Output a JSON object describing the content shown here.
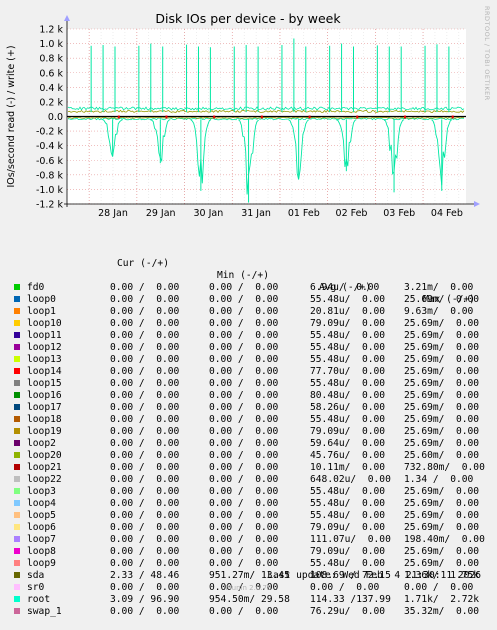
{
  "chart_data": {
    "type": "line",
    "title": "Disk IOs per device - by week",
    "ylabel": "IOs/second read (-) / write (+)",
    "ylim": [
      -1200,
      1200
    ],
    "yticks": [
      -1200,
      -1000,
      -800,
      -600,
      -400,
      -200,
      0,
      200,
      400,
      600,
      800,
      1000,
      1200
    ],
    "ytick_labels": [
      "-1.2 k",
      "-1.0 k",
      "-0.8 k",
      "-0.6 k",
      "-0.4 k",
      "-0.2 k",
      "0.0",
      "0.2 k",
      "0.4 k",
      "0.6 k",
      "0.8 k",
      "1.0 k",
      "1.2 k"
    ],
    "xticks": [
      "28 Jan",
      "29 Jan",
      "30 Jan",
      "31 Jan",
      "01 Feb",
      "02 Feb",
      "03 Feb",
      "04 Feb"
    ],
    "grid": true,
    "colors": {
      "sda": "#999900",
      "root": "#00e7a3",
      "loop14": "#ee0000",
      "baseline": "#000000"
    },
    "spikes_write": [
      {
        "day": 0.0,
        "v": 970
      },
      {
        "day": 0.25,
        "v": 980
      },
      {
        "day": 0.5,
        "v": 960
      },
      {
        "day": 1.0,
        "v": 970
      },
      {
        "day": 1.25,
        "v": 1000
      },
      {
        "day": 1.5,
        "v": 960
      },
      {
        "day": 2.0,
        "v": 985
      },
      {
        "day": 2.25,
        "v": 960
      },
      {
        "day": 2.5,
        "v": 950
      },
      {
        "day": 3.0,
        "v": 960
      },
      {
        "day": 3.25,
        "v": 980
      },
      {
        "day": 3.5,
        "v": 960
      },
      {
        "day": 4.0,
        "v": 980
      },
      {
        "day": 4.25,
        "v": 1070
      },
      {
        "day": 4.5,
        "v": 960
      },
      {
        "day": 5.0,
        "v": 970
      },
      {
        "day": 5.25,
        "v": 1000
      },
      {
        "day": 5.5,
        "v": 960
      },
      {
        "day": 6.0,
        "v": 975
      },
      {
        "day": 6.25,
        "v": 960
      },
      {
        "day": 6.5,
        "v": 960
      },
      {
        "day": 7.0,
        "v": 970
      },
      {
        "day": 7.25,
        "v": 990
      },
      {
        "day": 7.5,
        "v": 960
      }
    ],
    "spikes_read": [
      {
        "day": 0.45,
        "v": -550
      },
      {
        "day": 1.45,
        "v": -640
      },
      {
        "day": 2.3,
        "v": -1020
      },
      {
        "day": 3.3,
        "v": -1180
      },
      {
        "day": 4.35,
        "v": -840
      },
      {
        "day": 5.35,
        "v": -750
      },
      {
        "day": 6.35,
        "v": -1040
      },
      {
        "day": 7.35,
        "v": -1020
      }
    ]
  },
  "legend": {
    "headers": {
      "cur": "Cur (-/+)",
      "min": "Min (-/+)",
      "avg": "Avg (-/+)",
      "max": "Max (-/+)"
    },
    "rows": [
      {
        "name": "fd0",
        "color": "#00cc00",
        "cur": "0.00 /  0.00",
        "min": "0.00 /  0.00",
        "avg": "6.94u/  0.00",
        "max": "3.21m/  0.00"
      },
      {
        "name": "loop0",
        "color": "#0066b3",
        "cur": "0.00 /  0.00",
        "min": "0.00 /  0.00",
        "avg": "55.48u/  0.00",
        "max": "25.69m/  0.00"
      },
      {
        "name": "loop1",
        "color": "#ff8000",
        "cur": "0.00 /  0.00",
        "min": "0.00 /  0.00",
        "avg": "20.81u/  0.00",
        "max": "9.63m/  0.00"
      },
      {
        "name": "loop10",
        "color": "#ffcc00",
        "cur": "0.00 /  0.00",
        "min": "0.00 /  0.00",
        "avg": "79.09u/  0.00",
        "max": "25.69m/  0.00"
      },
      {
        "name": "loop11",
        "color": "#330099",
        "cur": "0.00 /  0.00",
        "min": "0.00 /  0.00",
        "avg": "55.48u/  0.00",
        "max": "25.69m/  0.00"
      },
      {
        "name": "loop12",
        "color": "#990099",
        "cur": "0.00 /  0.00",
        "min": "0.00 /  0.00",
        "avg": "55.48u/  0.00",
        "max": "25.69m/  0.00"
      },
      {
        "name": "loop13",
        "color": "#ccff00",
        "cur": "0.00 /  0.00",
        "min": "0.00 /  0.00",
        "avg": "55.48u/  0.00",
        "max": "25.69m/  0.00"
      },
      {
        "name": "loop14",
        "color": "#ff0000",
        "cur": "0.00 /  0.00",
        "min": "0.00 /  0.00",
        "avg": "77.70u/  0.00",
        "max": "25.69m/  0.00"
      },
      {
        "name": "loop15",
        "color": "#808080",
        "cur": "0.00 /  0.00",
        "min": "0.00 /  0.00",
        "avg": "55.48u/  0.00",
        "max": "25.69m/  0.00"
      },
      {
        "name": "loop16",
        "color": "#008f00",
        "cur": "0.00 /  0.00",
        "min": "0.00 /  0.00",
        "avg": "80.48u/  0.00",
        "max": "25.69m/  0.00"
      },
      {
        "name": "loop17",
        "color": "#00487d",
        "cur": "0.00 /  0.00",
        "min": "0.00 /  0.00",
        "avg": "58.26u/  0.00",
        "max": "25.69m/  0.00"
      },
      {
        "name": "loop18",
        "color": "#b35a00",
        "cur": "0.00 /  0.00",
        "min": "0.00 /  0.00",
        "avg": "55.48u/  0.00",
        "max": "25.69m/  0.00"
      },
      {
        "name": "loop19",
        "color": "#b38f00",
        "cur": "0.00 /  0.00",
        "min": "0.00 /  0.00",
        "avg": "79.09u/  0.00",
        "max": "25.69m/  0.00"
      },
      {
        "name": "loop2",
        "color": "#6b006b",
        "cur": "0.00 /  0.00",
        "min": "0.00 /  0.00",
        "avg": "59.64u/  0.00",
        "max": "25.69m/  0.00"
      },
      {
        "name": "loop20",
        "color": "#8fb300",
        "cur": "0.00 /  0.00",
        "min": "0.00 /  0.00",
        "avg": "45.76u/  0.00",
        "max": "25.60m/  0.00"
      },
      {
        "name": "loop21",
        "color": "#b30000",
        "cur": "0.00 /  0.00",
        "min": "0.00 /  0.00",
        "avg": "10.11m/  0.00",
        "max": "732.80m/  0.00"
      },
      {
        "name": "loop22",
        "color": "#bebebe",
        "cur": "0.00 /  0.00",
        "min": "0.00 /  0.00",
        "avg": "648.02u/  0.00",
        "max": "1.34 /  0.00"
      },
      {
        "name": "loop3",
        "color": "#80ff80",
        "cur": "0.00 /  0.00",
        "min": "0.00 /  0.00",
        "avg": "55.48u/  0.00",
        "max": "25.69m/  0.00"
      },
      {
        "name": "loop4",
        "color": "#80c9ff",
        "cur": "0.00 /  0.00",
        "min": "0.00 /  0.00",
        "avg": "55.48u/  0.00",
        "max": "25.69m/  0.00"
      },
      {
        "name": "loop5",
        "color": "#ffc080",
        "cur": "0.00 /  0.00",
        "min": "0.00 /  0.00",
        "avg": "55.48u/  0.00",
        "max": "25.69m/  0.00"
      },
      {
        "name": "loop6",
        "color": "#ffe680",
        "cur": "0.00 /  0.00",
        "min": "0.00 /  0.00",
        "avg": "79.09u/  0.00",
        "max": "25.69m/  0.00"
      },
      {
        "name": "loop7",
        "color": "#aa80ff",
        "cur": "0.00 /  0.00",
        "min": "0.00 /  0.00",
        "avg": "111.07u/  0.00",
        "max": "198.40m/  0.00"
      },
      {
        "name": "loop8",
        "color": "#ee00cc",
        "cur": "0.00 /  0.00",
        "min": "0.00 /  0.00",
        "avg": "79.09u/  0.00",
        "max": "25.69m/  0.00"
      },
      {
        "name": "loop9",
        "color": "#ff8080",
        "cur": "0.00 /  0.00",
        "min": "0.00 /  0.00",
        "avg": "55.48u/  0.00",
        "max": "25.69m/  0.00"
      },
      {
        "name": "sda",
        "color": "#666600",
        "cur": "2.33 / 48.46",
        "min": "951.27m/ 13.45",
        "avg": "108.69 / 72.15",
        "max": "1.36k/  1.75k"
      },
      {
        "name": "sr0",
        "color": "#ffbfff",
        "cur": "0.00 /  0.00",
        "min": "0.00 /  0.00",
        "avg": "0.00 /  0.00",
        "max": "0.00 /  0.00"
      },
      {
        "name": "root",
        "color": "#00ffcc",
        "cur": "3.09 / 96.90",
        "min": "954.50m/ 29.58",
        "avg": "114.33 /137.99",
        "max": "1.71k/  2.72k"
      },
      {
        "name": "swap_1",
        "color": "#cc6699",
        "cur": "0.00 /  0.00",
        "min": "0.00 /  0.00",
        "avg": "76.29u/  0.00",
        "max": "35.32m/  0.00"
      }
    ]
  },
  "footer": {
    "last_update": "Last update: Wed Feb  4 21:30:11 2026",
    "munin": "Munin 2.0.75",
    "rrd": "RRDTOOL / TOBI OETIKER"
  }
}
